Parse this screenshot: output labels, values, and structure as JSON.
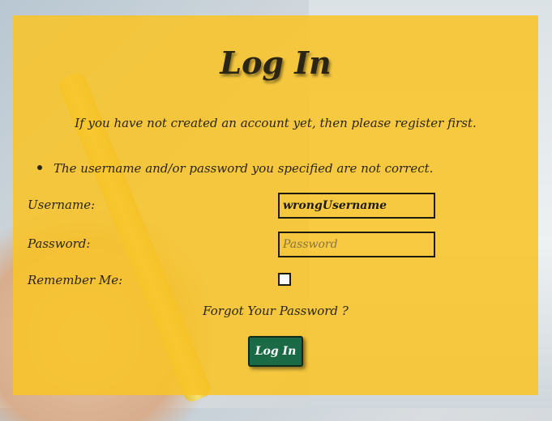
{
  "page": {
    "title": "Log In",
    "intro": "If you have not created an account yet, then please register first.",
    "error_message": "The username and/or password you specified are not correct."
  },
  "form": {
    "username_label": "Username:",
    "username_value": "wrongUsername",
    "password_label": "Password:",
    "password_placeholder": "Password",
    "remember_label": "Remember Me:",
    "forgot_link": "Forgot Your Password ?",
    "login_button": "Log In"
  },
  "colors": {
    "panel": "#f8c428",
    "button": "#1a6a45",
    "text": "#2b2516"
  }
}
